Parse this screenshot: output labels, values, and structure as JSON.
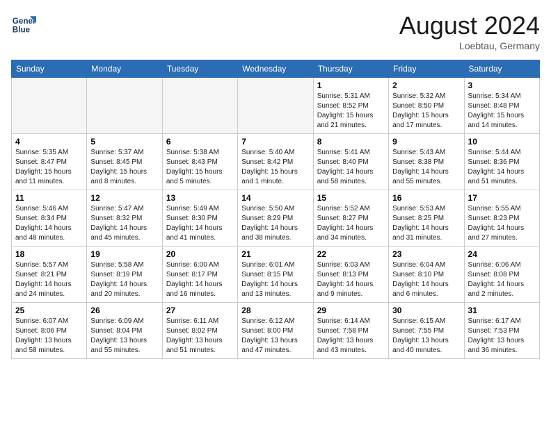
{
  "header": {
    "logo_line1": "General",
    "logo_line2": "Blue",
    "month": "August 2024",
    "location": "Loebtau, Germany"
  },
  "days_of_week": [
    "Sunday",
    "Monday",
    "Tuesday",
    "Wednesday",
    "Thursday",
    "Friday",
    "Saturday"
  ],
  "weeks": [
    [
      {
        "day": "",
        "detail": ""
      },
      {
        "day": "",
        "detail": ""
      },
      {
        "day": "",
        "detail": ""
      },
      {
        "day": "",
        "detail": ""
      },
      {
        "day": "1",
        "detail": "Sunrise: 5:31 AM\nSunset: 8:52 PM\nDaylight: 15 hours and 21 minutes."
      },
      {
        "day": "2",
        "detail": "Sunrise: 5:32 AM\nSunset: 8:50 PM\nDaylight: 15 hours and 17 minutes."
      },
      {
        "day": "3",
        "detail": "Sunrise: 5:34 AM\nSunset: 8:48 PM\nDaylight: 15 hours and 14 minutes."
      }
    ],
    [
      {
        "day": "4",
        "detail": "Sunrise: 5:35 AM\nSunset: 8:47 PM\nDaylight: 15 hours and 11 minutes."
      },
      {
        "day": "5",
        "detail": "Sunrise: 5:37 AM\nSunset: 8:45 PM\nDaylight: 15 hours and 8 minutes."
      },
      {
        "day": "6",
        "detail": "Sunrise: 5:38 AM\nSunset: 8:43 PM\nDaylight: 15 hours and 5 minutes."
      },
      {
        "day": "7",
        "detail": "Sunrise: 5:40 AM\nSunset: 8:42 PM\nDaylight: 15 hours and 1 minute."
      },
      {
        "day": "8",
        "detail": "Sunrise: 5:41 AM\nSunset: 8:40 PM\nDaylight: 14 hours and 58 minutes."
      },
      {
        "day": "9",
        "detail": "Sunrise: 5:43 AM\nSunset: 8:38 PM\nDaylight: 14 hours and 55 minutes."
      },
      {
        "day": "10",
        "detail": "Sunrise: 5:44 AM\nSunset: 8:36 PM\nDaylight: 14 hours and 51 minutes."
      }
    ],
    [
      {
        "day": "11",
        "detail": "Sunrise: 5:46 AM\nSunset: 8:34 PM\nDaylight: 14 hours and 48 minutes."
      },
      {
        "day": "12",
        "detail": "Sunrise: 5:47 AM\nSunset: 8:32 PM\nDaylight: 14 hours and 45 minutes."
      },
      {
        "day": "13",
        "detail": "Sunrise: 5:49 AM\nSunset: 8:30 PM\nDaylight: 14 hours and 41 minutes."
      },
      {
        "day": "14",
        "detail": "Sunrise: 5:50 AM\nSunset: 8:29 PM\nDaylight: 14 hours and 38 minutes."
      },
      {
        "day": "15",
        "detail": "Sunrise: 5:52 AM\nSunset: 8:27 PM\nDaylight: 14 hours and 34 minutes."
      },
      {
        "day": "16",
        "detail": "Sunrise: 5:53 AM\nSunset: 8:25 PM\nDaylight: 14 hours and 31 minutes."
      },
      {
        "day": "17",
        "detail": "Sunrise: 5:55 AM\nSunset: 8:23 PM\nDaylight: 14 hours and 27 minutes."
      }
    ],
    [
      {
        "day": "18",
        "detail": "Sunrise: 5:57 AM\nSunset: 8:21 PM\nDaylight: 14 hours and 24 minutes."
      },
      {
        "day": "19",
        "detail": "Sunrise: 5:58 AM\nSunset: 8:19 PM\nDaylight: 14 hours and 20 minutes."
      },
      {
        "day": "20",
        "detail": "Sunrise: 6:00 AM\nSunset: 8:17 PM\nDaylight: 14 hours and 16 minutes."
      },
      {
        "day": "21",
        "detail": "Sunrise: 6:01 AM\nSunset: 8:15 PM\nDaylight: 14 hours and 13 minutes."
      },
      {
        "day": "22",
        "detail": "Sunrise: 6:03 AM\nSunset: 8:13 PM\nDaylight: 14 hours and 9 minutes."
      },
      {
        "day": "23",
        "detail": "Sunrise: 6:04 AM\nSunset: 8:10 PM\nDaylight: 14 hours and 6 minutes."
      },
      {
        "day": "24",
        "detail": "Sunrise: 6:06 AM\nSunset: 8:08 PM\nDaylight: 14 hours and 2 minutes."
      }
    ],
    [
      {
        "day": "25",
        "detail": "Sunrise: 6:07 AM\nSunset: 8:06 PM\nDaylight: 13 hours and 58 minutes."
      },
      {
        "day": "26",
        "detail": "Sunrise: 6:09 AM\nSunset: 8:04 PM\nDaylight: 13 hours and 55 minutes."
      },
      {
        "day": "27",
        "detail": "Sunrise: 6:11 AM\nSunset: 8:02 PM\nDaylight: 13 hours and 51 minutes."
      },
      {
        "day": "28",
        "detail": "Sunrise: 6:12 AM\nSunset: 8:00 PM\nDaylight: 13 hours and 47 minutes."
      },
      {
        "day": "29",
        "detail": "Sunrise: 6:14 AM\nSunset: 7:58 PM\nDaylight: 13 hours and 43 minutes."
      },
      {
        "day": "30",
        "detail": "Sunrise: 6:15 AM\nSunset: 7:55 PM\nDaylight: 13 hours and 40 minutes."
      },
      {
        "day": "31",
        "detail": "Sunrise: 6:17 AM\nSunset: 7:53 PM\nDaylight: 13 hours and 36 minutes."
      }
    ]
  ]
}
